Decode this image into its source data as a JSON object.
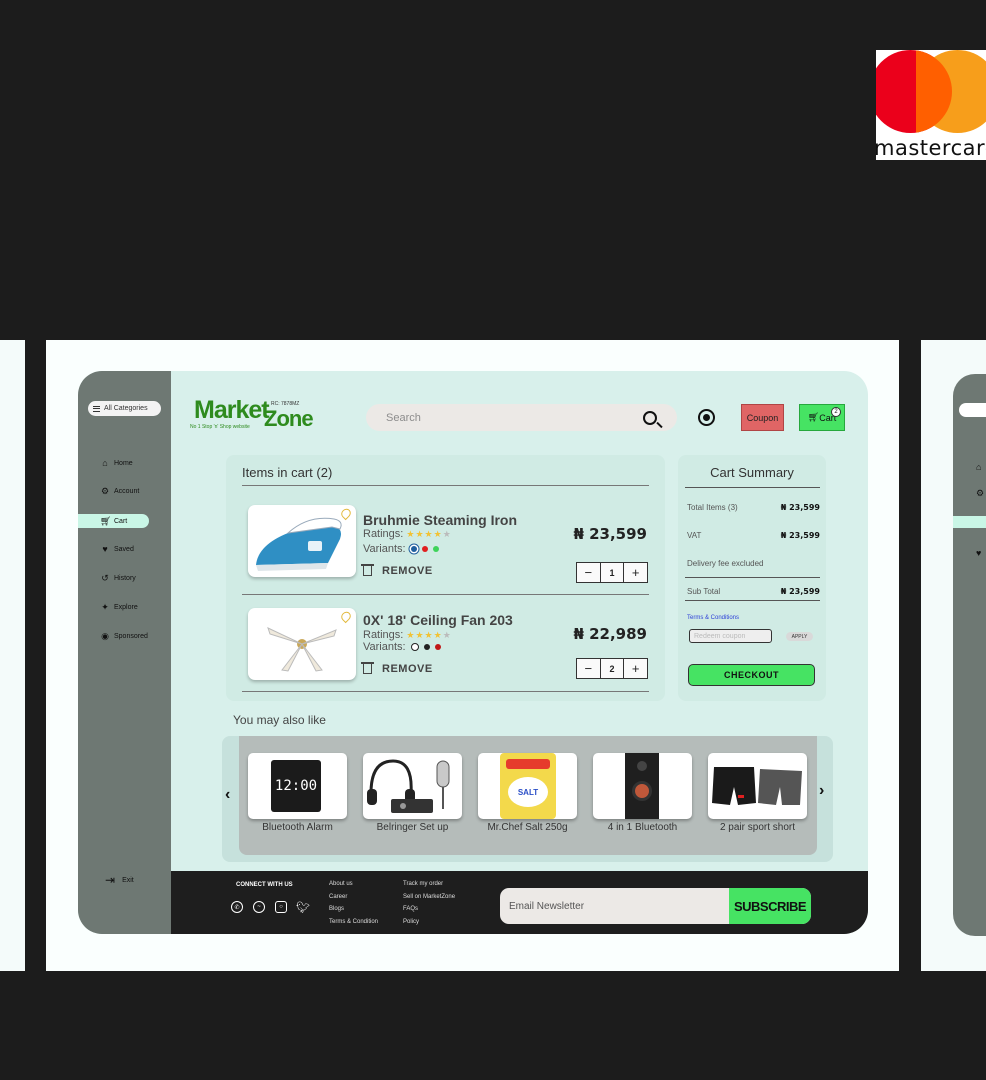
{
  "brand": {
    "logo_word1": "Market",
    "logo_word2": "Zone",
    "rc": "RC: 7878MZ",
    "tagline": "No 1 Stop 'n' Shop website",
    "accent": "#2e8b1e"
  },
  "mastercard_logo": {
    "text": "mastercard",
    "colors": [
      "#eb001b",
      "#f79e1b",
      "#ff5f00"
    ]
  },
  "sidebar": {
    "categories_label": "All Categories",
    "items": [
      {
        "label": "Home",
        "icon": "home-icon"
      },
      {
        "label": "Account",
        "icon": "gear-icon"
      },
      {
        "label": "Cart",
        "icon": "cart-icon",
        "active": true
      },
      {
        "label": "Saved",
        "icon": "heart-icon"
      },
      {
        "label": "History",
        "icon": "history-icon"
      },
      {
        "label": "Explore",
        "icon": "explore-icon"
      },
      {
        "label": "Sponsored",
        "icon": "sponsored-icon"
      }
    ],
    "exit_label": "Exit"
  },
  "header": {
    "search_placeholder": "Search",
    "coupon_label": "Coupon",
    "cart_label": "Cart",
    "cart_count": "2"
  },
  "cart": {
    "title": "Items in cart (2)",
    "ratings_label": "Ratings:",
    "variants_label": "Variants:",
    "remove_label": "REMOVE",
    "items": [
      {
        "name": "Bruhmie Steaming Iron",
        "price": "₦ 23,599",
        "qty": "1",
        "stars": 4,
        "variants": [
          "#1f5f9e",
          "#e02020",
          "#3ed35a"
        ]
      },
      {
        "name": "0X' 18' Ceiling Fan 203",
        "price": "₦ 22,989",
        "qty": "2",
        "stars": 4,
        "variants": [
          "#ffffff",
          "#222222",
          "#e02020"
        ]
      }
    ]
  },
  "summary": {
    "title": "Cart Summary",
    "total_items_label": "Total Items (3)",
    "total_items_value": "₦ 23,599",
    "vat_label": "VAT",
    "vat_value": "₦ 23,599",
    "delivery_label": "Delivery fee excluded",
    "subtotal_label": "Sub Total",
    "subtotal_value": "₦ 23,599",
    "terms_label": "Terms & Conditions",
    "coupon_placeholder": "Redeem coupon",
    "apply_label": "APPLY",
    "checkout_label": "CHECKOUT"
  },
  "recommend": {
    "title": "You may also like",
    "items": [
      {
        "label": "Bluetooth Alarm",
        "clock_text": "12:00"
      },
      {
        "label": "Belringer Set up"
      },
      {
        "label": "Mr.Chef Salt 250g",
        "pack_text": "SALT"
      },
      {
        "label": "4 in 1 Bluetooth"
      },
      {
        "label": "2 pair sport short"
      }
    ]
  },
  "footer": {
    "connect_label": "CONNECT WITH US",
    "col1": [
      "About us",
      "Career",
      "Blogs",
      "Terms & Condition"
    ],
    "col2": [
      "Track my order",
      "Sell on MarketZone",
      "FAQs",
      "Policy"
    ],
    "newsletter_placeholder": "Email Newsletter",
    "subscribe_label": "SUBSCRIBE"
  }
}
